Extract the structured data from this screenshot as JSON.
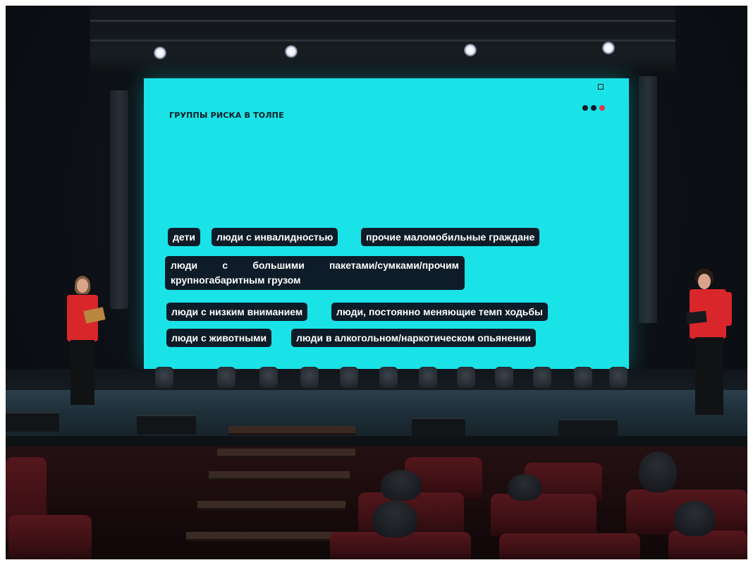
{
  "slide": {
    "title": "ГРУППЫ РИСКА В ТОЛПЕ",
    "indicator_dots": [
      "#0d1c28",
      "#0d1c28",
      "#e0374a"
    ],
    "screen_color": "#19e3e7",
    "tag_color": "#0d1c28",
    "tags": [
      "дети",
      "люди с инвалидностью",
      "прочие маломобильные граждане",
      "люди с большими пакетами/сумками/прочим крупногабаритным грузом",
      "люди с низким вниманием",
      "люди, постоянно меняющие темп ходьбы",
      "люди с животными",
      "люди в алкогольном/наркотическом опьянении"
    ]
  },
  "presenters": {
    "vest_color": "#d9262b",
    "count": 2
  }
}
